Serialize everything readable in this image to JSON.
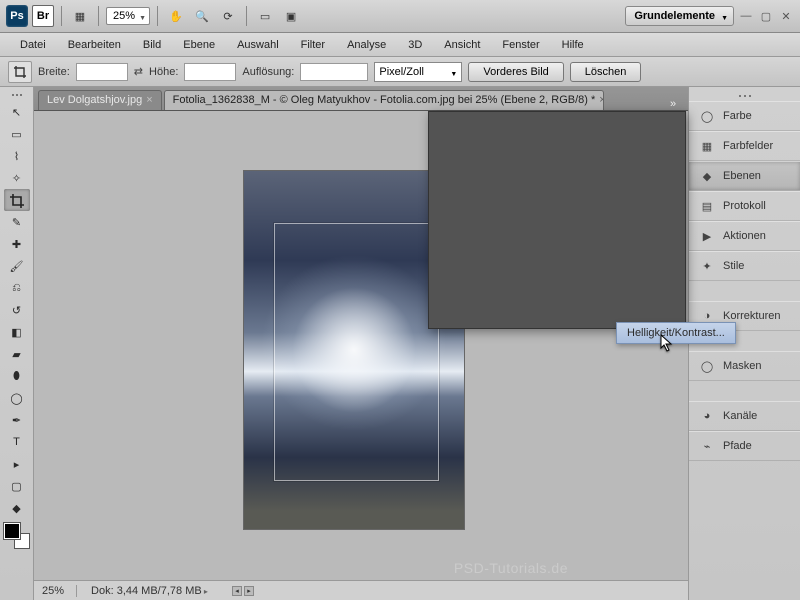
{
  "topbar": {
    "zoom": "25%",
    "workspace": "Grundelemente"
  },
  "menu": [
    "Datei",
    "Bearbeiten",
    "Bild",
    "Ebene",
    "Auswahl",
    "Filter",
    "Analyse",
    "3D",
    "Ansicht",
    "Fenster",
    "Hilfe"
  ],
  "optbar": {
    "width_label": "Breite:",
    "height_label": "Höhe:",
    "resolution_label": "Auflösung:",
    "unit": "Pixel/Zoll",
    "btn_front": "Vorderes Bild",
    "btn_clear": "Löschen"
  },
  "tabs": [
    {
      "label": "Lev Dolgatshjov.jpg",
      "active": false
    },
    {
      "label": "Fotolia_1362838_M - © Oleg Matyukhov - Fotolia.com.jpg bei 25% (Ebene 2, RGB/8) *",
      "active": true
    }
  ],
  "panels": [
    {
      "id": "farbe",
      "label": "Farbe"
    },
    {
      "id": "farbfelder",
      "label": "Farbfelder"
    },
    {
      "id": "ebenen",
      "label": "Ebenen",
      "active": true
    },
    {
      "id": "protokoll",
      "label": "Protokoll"
    },
    {
      "id": "aktionen",
      "label": "Aktionen"
    },
    {
      "id": "stile",
      "label": "Stile"
    },
    {
      "id": "korrekturen",
      "label": "Korrekturen"
    },
    {
      "id": "masken",
      "label": "Masken"
    },
    {
      "id": "kanaele",
      "label": "Kanäle"
    },
    {
      "id": "pfade",
      "label": "Pfade"
    }
  ],
  "flyout": "Helligkeit/Kontrast...",
  "status": {
    "zoom": "25%",
    "doc": "Dok: 3,44 MB/7,78 MB"
  },
  "watermark": "PSD-Tutorials.de"
}
